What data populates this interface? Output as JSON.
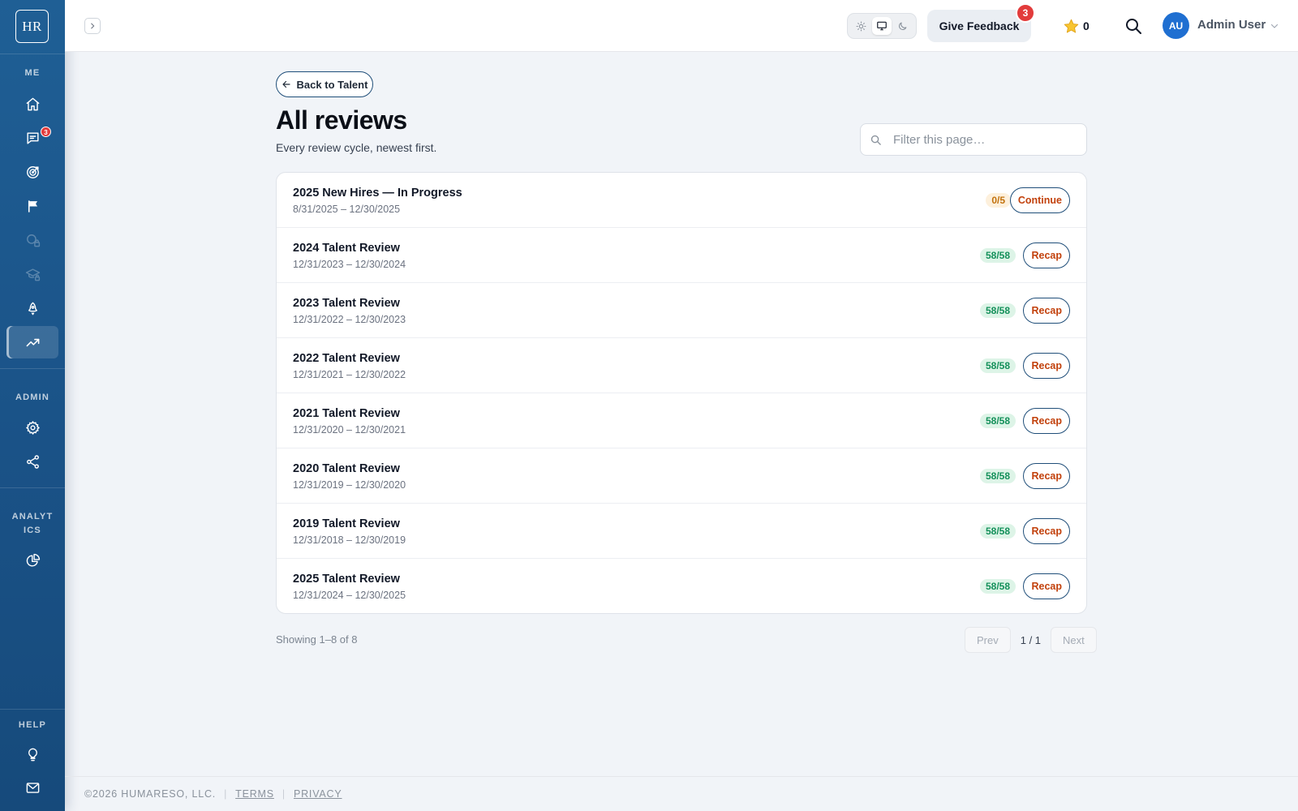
{
  "app": {
    "logo_text": "HR"
  },
  "sidebar": {
    "sections": {
      "me": "ME",
      "admin": "ADMIN",
      "analytics": "ANALYT\nICS",
      "help": "HELP"
    },
    "items": [
      {
        "icon": "home-icon",
        "state": "normal"
      },
      {
        "icon": "chat-icon",
        "state": "normal",
        "badge": "3"
      },
      {
        "icon": "target-icon",
        "state": "normal"
      },
      {
        "icon": "flag-icon",
        "state": "normal"
      },
      {
        "icon": "locked-search-icon",
        "state": "disabled"
      },
      {
        "icon": "locked-graduation-icon",
        "state": "disabled"
      },
      {
        "icon": "rocket-icon",
        "state": "normal"
      },
      {
        "icon": "trend-up-icon",
        "state": "active"
      },
      {
        "icon": "gear-icon",
        "state": "normal"
      },
      {
        "icon": "share-icon",
        "state": "normal"
      },
      {
        "icon": "pie-chart-icon",
        "state": "normal"
      },
      {
        "icon": "lightbulb-icon",
        "state": "normal"
      },
      {
        "icon": "mail-icon",
        "state": "normal"
      }
    ]
  },
  "topbar": {
    "feedback_label": "Give Feedback",
    "feedback_badge": "3",
    "stars_count": "0",
    "user_initials": "AU",
    "user_name": "Admin User",
    "theme_selected": "system"
  },
  "main": {
    "back_label": "Back to Talent",
    "title": "All reviews",
    "subtitle": "Every review cycle, newest first.",
    "filter_placeholder": "Filter this page…",
    "reviews": [
      {
        "title": "2025 New Hires — In Progress",
        "dates": "8/31/2025 – 12/30/2025",
        "progress": "0/5",
        "status": "progress",
        "action": "Continue"
      },
      {
        "title": "2024 Talent Review",
        "dates": "12/31/2023 – 12/30/2024",
        "progress": "58/58",
        "status": "done",
        "action": "Recap"
      },
      {
        "title": "2023 Talent Review",
        "dates": "12/31/2022 – 12/30/2023",
        "progress": "58/58",
        "status": "done",
        "action": "Recap"
      },
      {
        "title": "2022 Talent Review",
        "dates": "12/31/2021 – 12/30/2022",
        "progress": "58/58",
        "status": "done",
        "action": "Recap"
      },
      {
        "title": "2021 Talent Review",
        "dates": "12/31/2020 – 12/30/2021",
        "progress": "58/58",
        "status": "done",
        "action": "Recap"
      },
      {
        "title": "2020 Talent Review",
        "dates": "12/31/2019 – 12/30/2020",
        "progress": "58/58",
        "status": "done",
        "action": "Recap"
      },
      {
        "title": "2019 Talent Review",
        "dates": "12/31/2018 – 12/30/2019",
        "progress": "58/58",
        "status": "done",
        "action": "Recap"
      },
      {
        "title": "2025 Talent Review",
        "dates": "12/31/2024 – 12/30/2025",
        "progress": "58/58",
        "status": "done",
        "action": "Recap"
      }
    ],
    "showing": "Showing 1–8 of 8",
    "pagination": {
      "prev": "Prev",
      "page": "1 / 1",
      "next": "Next"
    }
  },
  "footer": {
    "copyright": "©2026 HUMARESO, LLC.",
    "terms": "TERMS",
    "privacy": "PRIVACY"
  },
  "colors": {
    "sidebar": "#1a5287",
    "accent_orange": "#c2410c",
    "success_green": "#14905a",
    "warning_amber": "#c2710c",
    "badge_red": "#e23b3b",
    "avatar_blue": "#1f6fd1"
  }
}
